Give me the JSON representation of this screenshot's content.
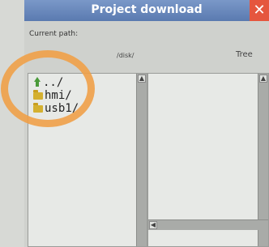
{
  "window": {
    "title": "Project download",
    "close_glyph": "✕"
  },
  "path": {
    "label": "Current path:",
    "value": "/disk/"
  },
  "tree": {
    "label": "Tree"
  },
  "files": [
    {
      "name": "../",
      "icon": "up-icon"
    },
    {
      "name": "hmi/",
      "icon": "folder-icon"
    },
    {
      "name": "usb1/",
      "icon": "folder-icon"
    }
  ],
  "colors": {
    "title_bar": "#5a7ab0",
    "close": "#e5563e",
    "annotation": "#f0a048"
  }
}
